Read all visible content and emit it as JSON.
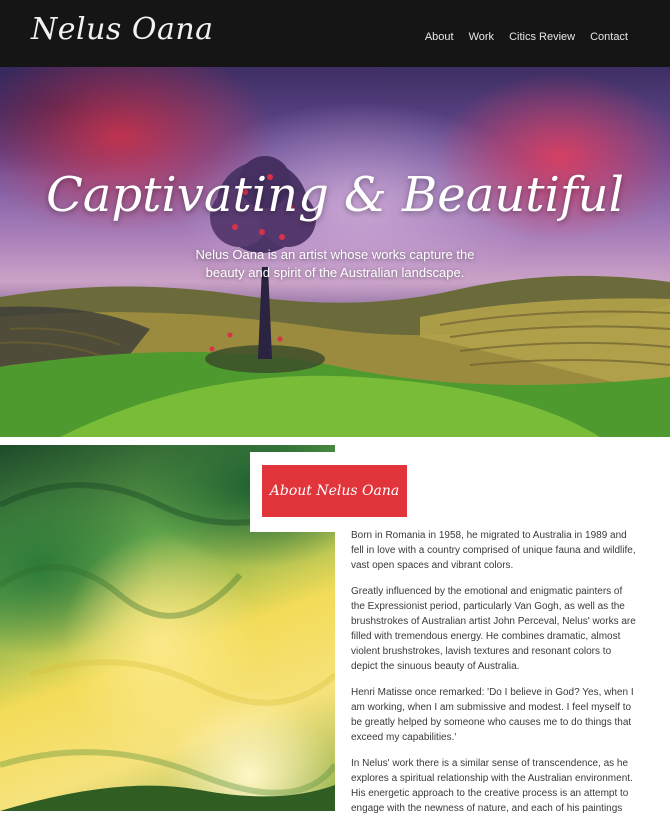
{
  "header": {
    "logo": "Nelus Oana",
    "nav": [
      "About",
      "Work",
      "Citics Review",
      "Contact"
    ]
  },
  "hero": {
    "title": "Captivating & Beautiful",
    "subtitle": "Nelus Oana is an artist whose works capture the beauty and spirit of the Australian landscape."
  },
  "about": {
    "title": "About Nelus Oana",
    "paragraphs": [
      "Born in Romania in 1958, he migrated to Australia in 1989 and fell in love with a country comprised of unique fauna and wildlife, vast open spaces and vibrant colors.",
      "Greatly influenced by the emotional and enigmatic painters of the Expressionist period, particularly Van Gogh, as well as the brushstrokes of Australian artist John Perceval, Nelus' works are filled with tremendous energy. He combines dramatic, almost violent brushstrokes, lavish textures and resonant colors to depict the sinuous beauty of Australia.",
      "Henri Matisse once remarked: 'Do I believe in God? Yes, when I am working, when I am submissive and modest. I feel myself to be greatly helped by someone who causes me to do things that exceed my capabilities.'",
      "In Nelus' work there is a similar sense of transcendence, as he explores a spiritual relationship with the Australian environment. His energetic approach to the creative process is an attempt to engage with the newness of nature, and each of his paintings"
    ]
  },
  "colors": {
    "header_bg": "#151515",
    "accent_red": "#e2353b"
  }
}
